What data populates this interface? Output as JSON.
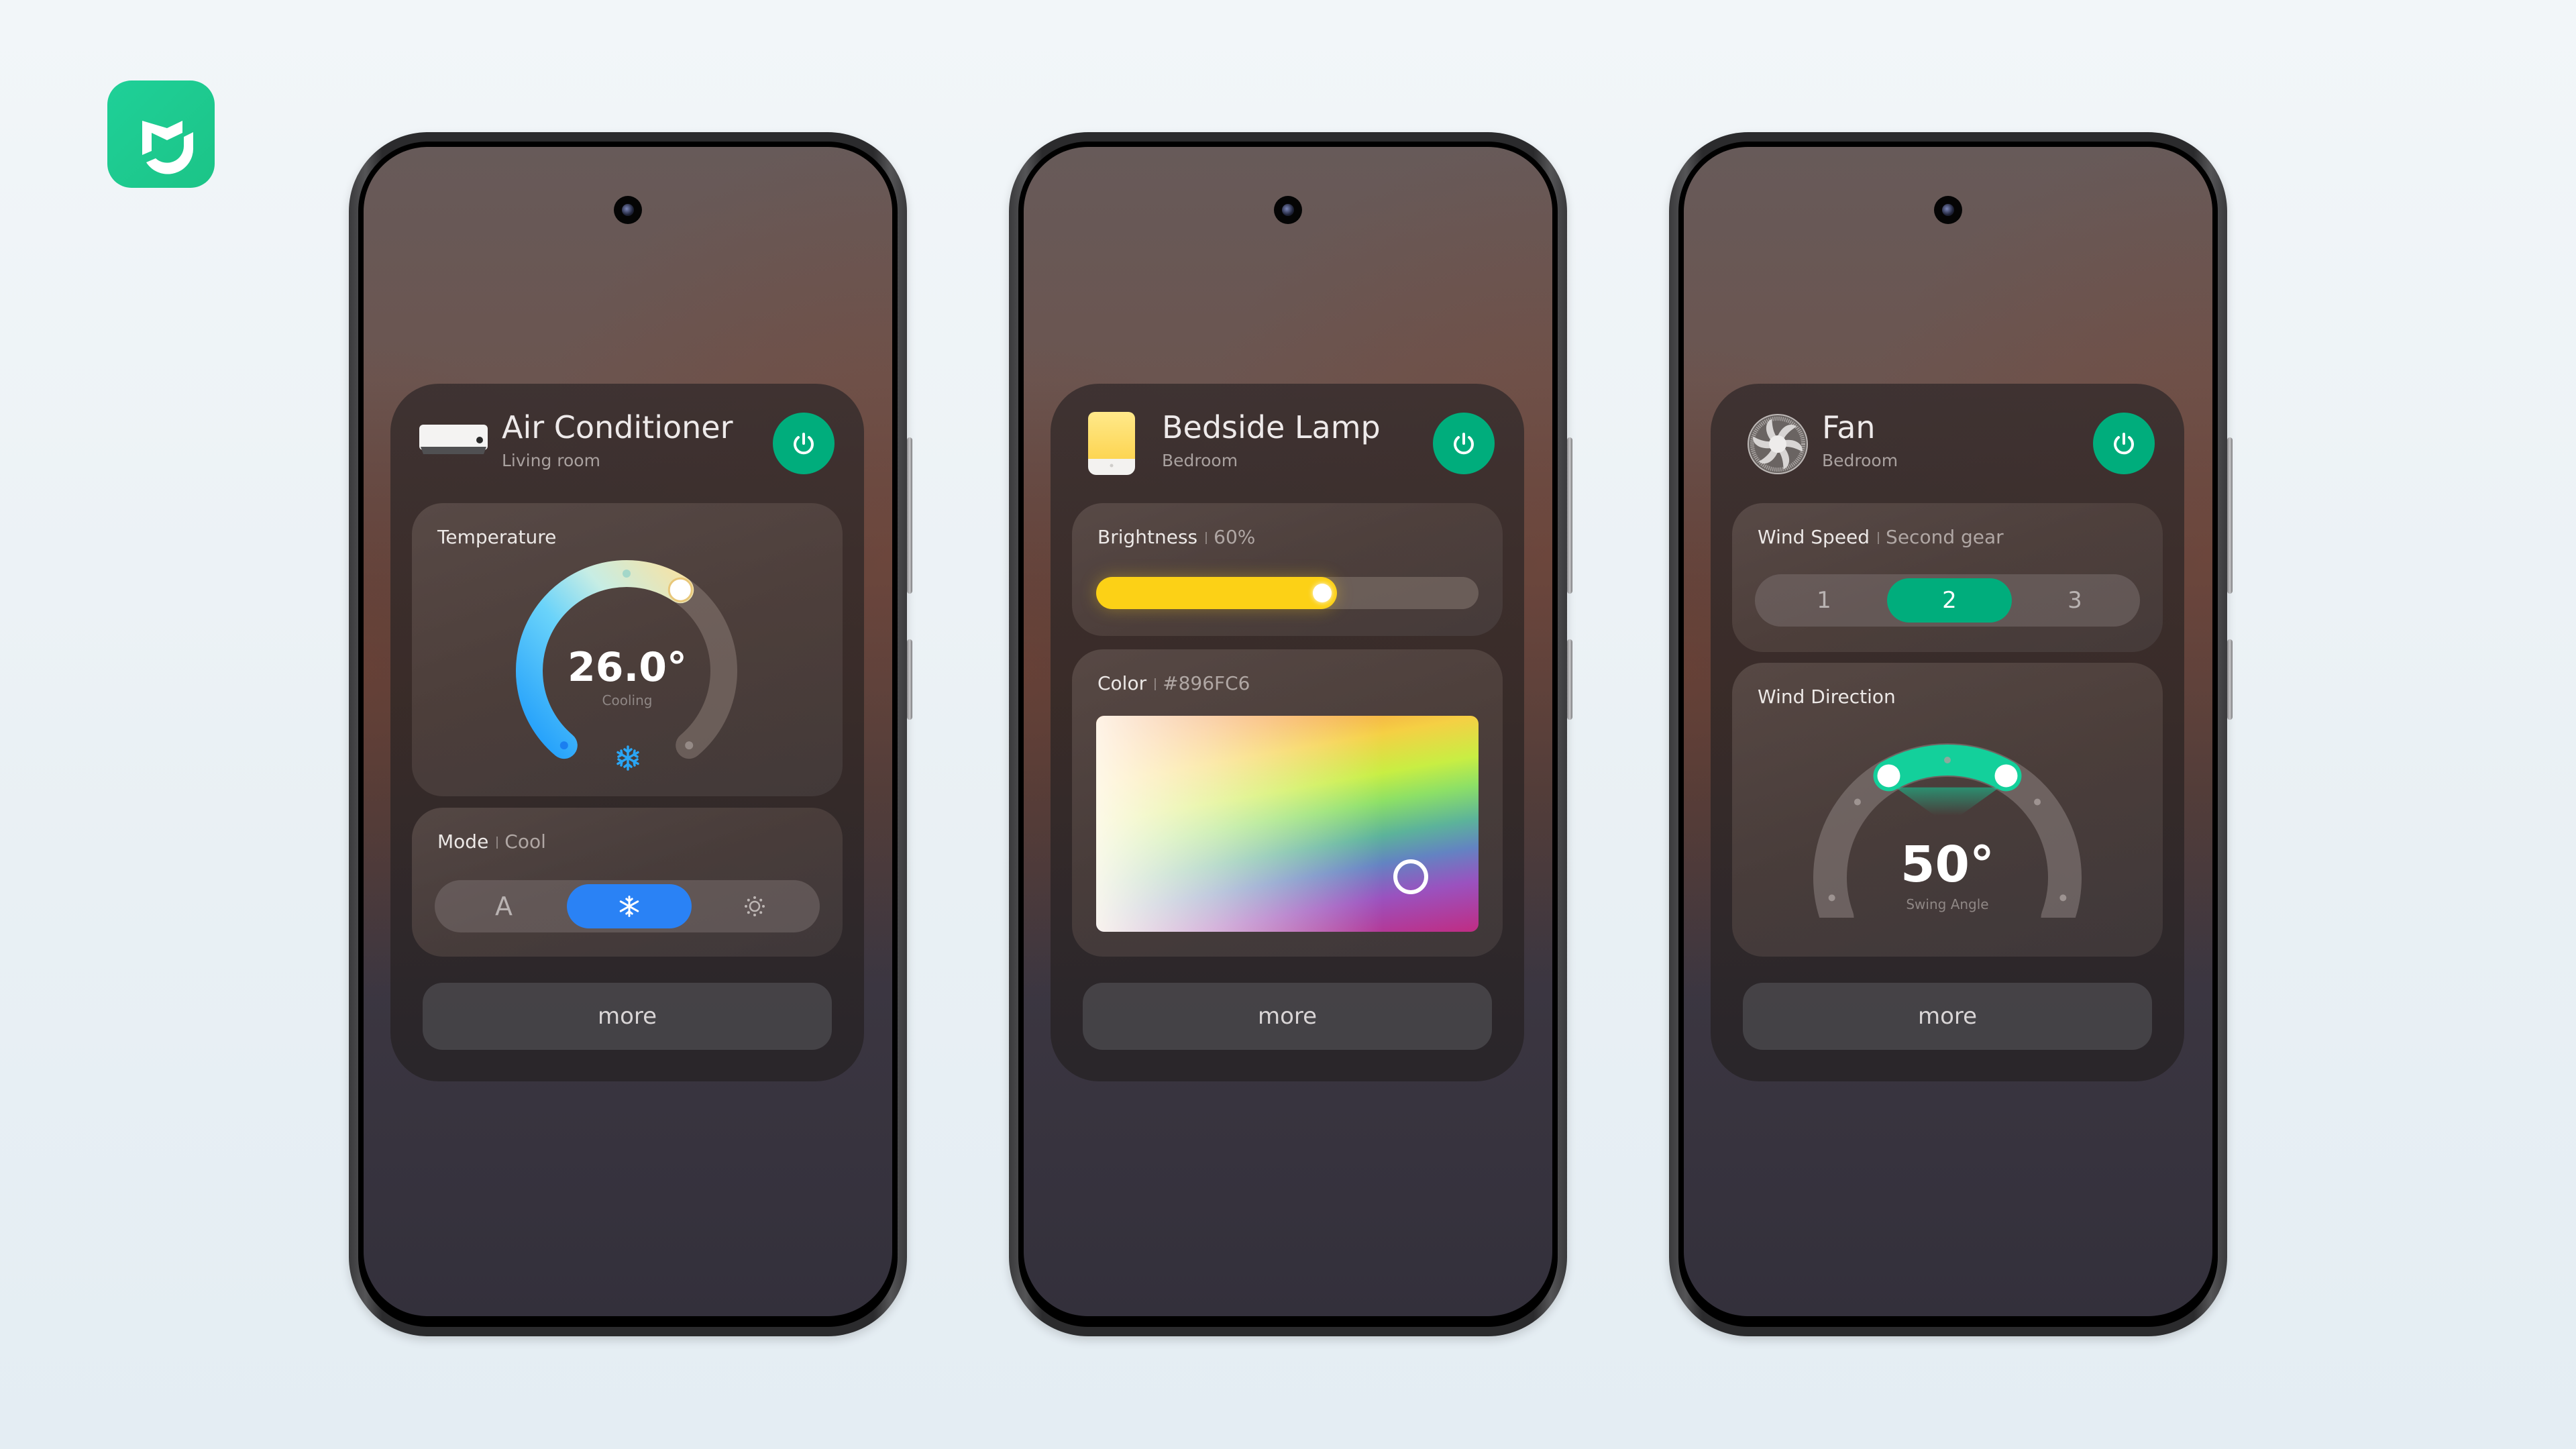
{
  "app": {
    "logo_icon": "mi-home-logo",
    "brand_color": "#1DCB90"
  },
  "devices": [
    {
      "type": "air-conditioner",
      "title": "Air Conditioner",
      "room": "Living room",
      "power": "on",
      "power_color": "#00AD7C",
      "temperature": {
        "label": "Temperature",
        "value_text": "26.0°",
        "status": "Cooling",
        "dial_fraction": 0.62,
        "mode_icon": "snowflake-icon"
      },
      "mode": {
        "label": "Mode",
        "value": "Cool",
        "options": [
          {
            "label": "A",
            "icon": "auto-icon",
            "active": false
          },
          {
            "label": "",
            "icon": "snowflake-icon",
            "active": true
          },
          {
            "label": "",
            "icon": "sun-icon",
            "active": false
          }
        ],
        "active_color": "#2A82F5"
      },
      "more_label": "more"
    },
    {
      "type": "bedside-lamp",
      "title": "Bedside Lamp",
      "room": "Bedroom",
      "power": "on",
      "power_color": "#00AD7C",
      "brightness": {
        "label": "Brightness",
        "value_text": "60%",
        "value_percent": 60,
        "fill_color": "#FCD116"
      },
      "color": {
        "label": "Color",
        "value_text": "#896FC6",
        "selected_hex": "#896FC6"
      },
      "more_label": "more"
    },
    {
      "type": "fan",
      "title": "Fan",
      "room": "Bedroom",
      "power": "on",
      "power_color": "#00AD7C",
      "wind_speed": {
        "label": "Wind Speed",
        "value": "Second gear",
        "options": [
          "1",
          "2",
          "3"
        ],
        "active_index": 1,
        "active_color": "#00AD7C"
      },
      "wind_direction": {
        "label": "Wind Direction",
        "value_text": "50°",
        "caption": "Swing Angle",
        "swing_degrees": 50,
        "arc_color": "#13D09B"
      },
      "more_label": "more"
    }
  ]
}
